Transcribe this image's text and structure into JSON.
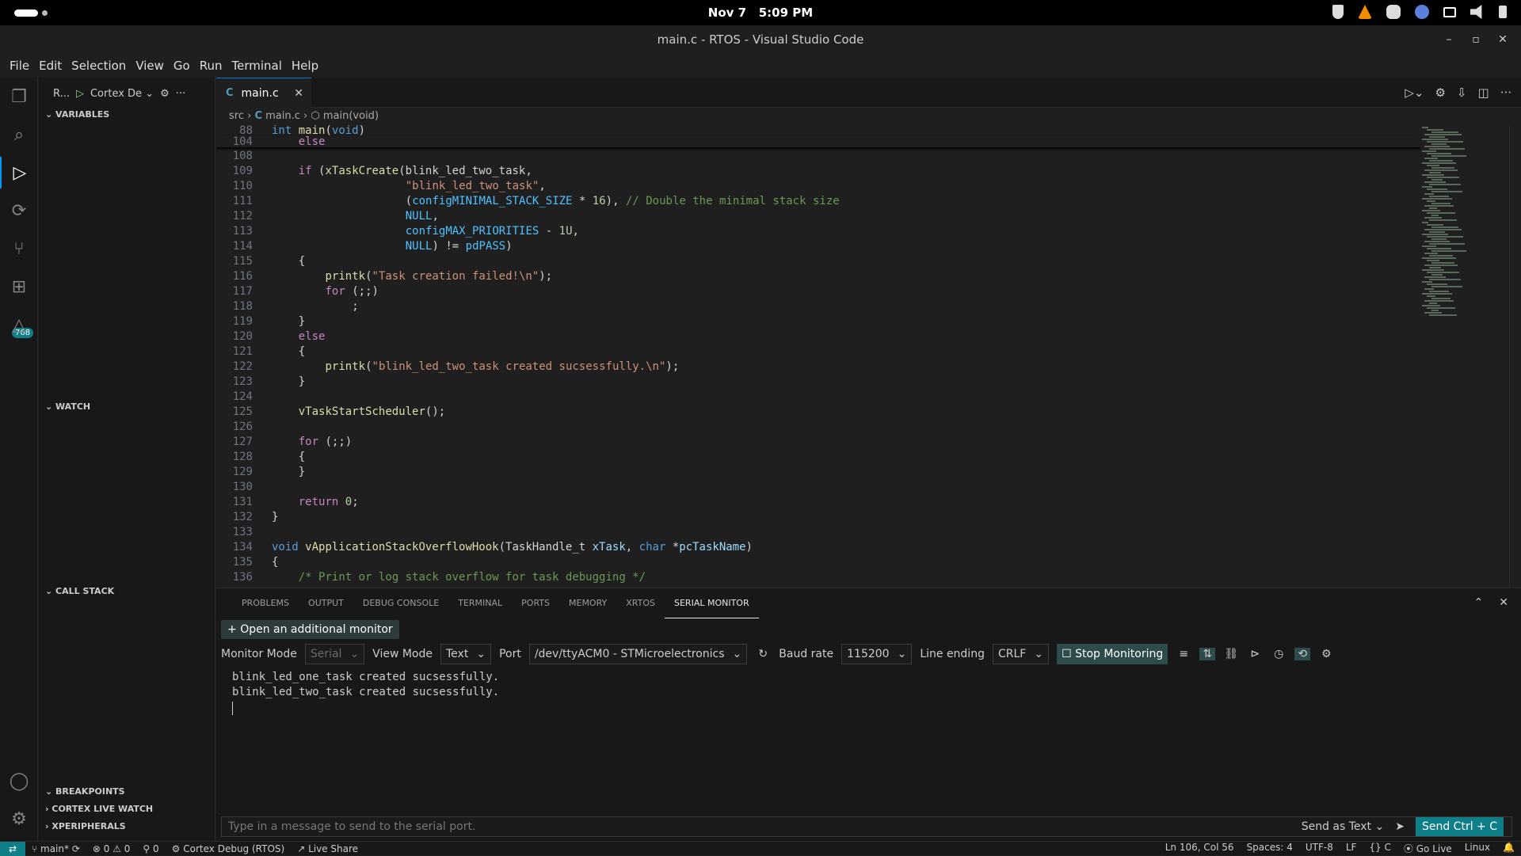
{
  "system": {
    "date": "Nov 7",
    "time": "5:09 PM"
  },
  "window": {
    "title": "main.c - RTOS - Visual Studio Code"
  },
  "menu": [
    "File",
    "Edit",
    "Selection",
    "View",
    "Go",
    "Run",
    "Terminal",
    "Help"
  ],
  "activity": {
    "badge": "768"
  },
  "sidebar": {
    "run_label": "R...",
    "config": "Cortex De",
    "sections": {
      "variables": "VARIABLES",
      "watch": "WATCH",
      "callstack": "CALL STACK",
      "breakpoints": "BREAKPOINTS",
      "livewatch": "CORTEX LIVE WATCH",
      "xperipherals": "XPERIPHERALS"
    }
  },
  "tab": {
    "lang": "C",
    "name": "main.c"
  },
  "breadcrumb": {
    "folder": "src",
    "file": "main.c",
    "symbol": "main(void)"
  },
  "panel": {
    "tabs": [
      "PROBLEMS",
      "OUTPUT",
      "DEBUG CONSOLE",
      "TERMINAL",
      "PORTS",
      "MEMORY",
      "XRTOS",
      "SERIAL MONITOR"
    ],
    "open_additional": "Open an additional monitor",
    "monitor_mode_label": "Monitor Mode",
    "monitor_mode": "Serial",
    "view_mode_label": "View Mode",
    "view_mode": "Text",
    "port_label": "Port",
    "port": "/dev/ttyACM0 - STMicroelectronics",
    "baud_label": "Baud rate",
    "baud": "115200",
    "line_ending_label": "Line ending",
    "line_ending": "CRLF",
    "stop": "Stop Monitoring",
    "output": "blink_led_one_task created sucsessfully.\nblink_led_two_task created sucsessfully.",
    "send_placeholder": "Type in a message to send to the serial port.",
    "send_as": "Send as Text",
    "send_ctrl": "Send Ctrl + C"
  },
  "status": {
    "branch": "main*",
    "errors": "0",
    "warnings": "0",
    "ports": "0",
    "debug": "Cortex Debug (RTOS)",
    "liveshare": "Live Share",
    "position": "Ln 106, Col 56",
    "spaces": "Spaces: 4",
    "encoding": "UTF-8",
    "eol": "LF",
    "lang": "C",
    "golive": "Go Live",
    "os": "Linux"
  },
  "code": {
    "sticky": [
      {
        "n": "88",
        "t": "int main(void)"
      },
      {
        "n": "104",
        "t": "    else"
      }
    ],
    "lines": [
      {
        "n": "108",
        "t": ""
      },
      {
        "n": "109",
        "t": "    if (xTaskCreate(blink_led_two_task,"
      },
      {
        "n": "110",
        "t": "                    \"blink_led_two_task\","
      },
      {
        "n": "111",
        "t": "                    (configMINIMAL_STACK_SIZE * 16), // Double the minimal stack size"
      },
      {
        "n": "112",
        "t": "                    NULL,"
      },
      {
        "n": "113",
        "t": "                    configMAX_PRIORITIES - 1U,"
      },
      {
        "n": "114",
        "t": "                    NULL) != pdPASS)"
      },
      {
        "n": "115",
        "t": "    {"
      },
      {
        "n": "116",
        "t": "        printk(\"Task creation failed!\\n\");"
      },
      {
        "n": "117",
        "t": "        for (;;)"
      },
      {
        "n": "118",
        "t": "            ;"
      },
      {
        "n": "119",
        "t": "    }"
      },
      {
        "n": "120",
        "t": "    else"
      },
      {
        "n": "121",
        "t": "    {"
      },
      {
        "n": "122",
        "t": "        printk(\"blink_led_two_task created sucsessfully.\\n\");"
      },
      {
        "n": "123",
        "t": "    }"
      },
      {
        "n": "124",
        "t": ""
      },
      {
        "n": "125",
        "t": "    vTaskStartScheduler();"
      },
      {
        "n": "126",
        "t": ""
      },
      {
        "n": "127",
        "t": "    for (;;)"
      },
      {
        "n": "128",
        "t": "    {"
      },
      {
        "n": "129",
        "t": "    }"
      },
      {
        "n": "130",
        "t": ""
      },
      {
        "n": "131",
        "t": "    return 0;"
      },
      {
        "n": "132",
        "t": "}"
      },
      {
        "n": "133",
        "t": ""
      },
      {
        "n": "134",
        "t": "void vApplicationStackOverflowHook(TaskHandle_t xTask, char *pcTaskName)"
      },
      {
        "n": "135",
        "t": "{"
      },
      {
        "n": "136",
        "t": "    /* Print or log stack overflow for task debugging */"
      }
    ]
  }
}
